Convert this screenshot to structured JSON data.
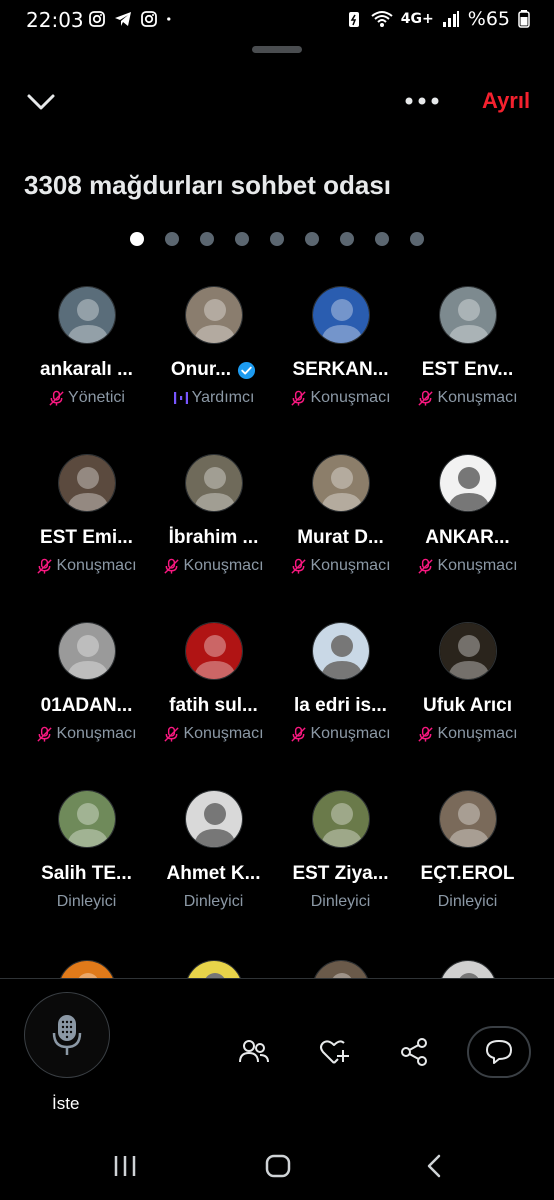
{
  "status": {
    "time": "22:03",
    "battery": "%65",
    "network": "4G+",
    "left_icons": [
      "instagram-icon",
      "telegram-icon",
      "instagram-icon",
      "dot-icon"
    ],
    "right_icons": [
      "battery-saver-icon",
      "wifi-icon",
      "signal-icon",
      "battery-icon"
    ]
  },
  "header": {
    "leave_label": "Ayrıl",
    "title": "3308 mağdurları sohbet odası",
    "page_count": 9,
    "active_page": 0
  },
  "participants": [
    {
      "name": "ankaralı ...",
      "role": "Yönetici",
      "role_icon": "mic-off-icon",
      "verified": false,
      "avatar_bg": "#5a6d7a"
    },
    {
      "name": "Onur...",
      "role": "Yardımcı",
      "role_icon": "audio-wave-icon",
      "verified": true,
      "avatar_bg": "#8a7d6e"
    },
    {
      "name": "SERKAN...",
      "role": "Konuşmacı",
      "role_icon": "mic-off-icon",
      "verified": false,
      "avatar_bg": "#2a5db0"
    },
    {
      "name": "EST Env...",
      "role": "Konuşmacı",
      "role_icon": "mic-off-icon",
      "verified": false,
      "avatar_bg": "#7d8a8f"
    },
    {
      "name": "EST Emi...",
      "role": "Konuşmacı",
      "role_icon": "mic-off-icon",
      "verified": false,
      "avatar_bg": "#5b4a3e"
    },
    {
      "name": "İbrahim ...",
      "role": "Konuşmacı",
      "role_icon": "mic-off-icon",
      "verified": false,
      "avatar_bg": "#6f6a5a"
    },
    {
      "name": "Murat D...",
      "role": "Konuşmacı",
      "role_icon": "mic-off-icon",
      "verified": false,
      "avatar_bg": "#8c7e6a"
    },
    {
      "name": "ANKAR...",
      "role": "Konuşmacı",
      "role_icon": "mic-off-icon",
      "verified": false,
      "avatar_bg": "#f2f2f2"
    },
    {
      "name": "01ADAN...",
      "role": "Konuşmacı",
      "role_icon": "mic-off-icon",
      "verified": false,
      "avatar_bg": "#9a9a9a"
    },
    {
      "name": "fatih sul...",
      "role": "Konuşmacı",
      "role_icon": "mic-off-icon",
      "verified": false,
      "avatar_bg": "#b01414"
    },
    {
      "name": "la edri is...",
      "role": "Konuşmacı",
      "role_icon": "mic-off-icon",
      "verified": false,
      "avatar_bg": "#c9d8e6"
    },
    {
      "name": "Ufuk Arıcı",
      "role": "Konuşmacı",
      "role_icon": "mic-off-icon",
      "verified": false,
      "avatar_bg": "#2a241c"
    },
    {
      "name": "Salih TE...",
      "role": "Dinleyici",
      "role_icon": "",
      "verified": false,
      "avatar_bg": "#6f8a5a"
    },
    {
      "name": "Ahmet K...",
      "role": "Dinleyici",
      "role_icon": "",
      "verified": false,
      "avatar_bg": "#d9d9d9"
    },
    {
      "name": "EST Ziya...",
      "role": "Dinleyici",
      "role_icon": "",
      "verified": false,
      "avatar_bg": "#6a7a4a"
    },
    {
      "name": "EÇT.EROL",
      "role": "Dinleyici",
      "role_icon": "",
      "verified": false,
      "avatar_bg": "#7a6a5a"
    }
  ],
  "partial_avatars": [
    "#e07a1a",
    "#e8d44a",
    "#6a5a4a",
    "#d0d0d0"
  ],
  "bottom": {
    "request_label": "İste",
    "controls": [
      "people-icon",
      "heart-plus-icon",
      "share-icon",
      "chat-icon"
    ]
  },
  "colors": {
    "accent_red": "#f4212e",
    "mic_off_pink": "#f91880",
    "verified_blue": "#1d9bf0",
    "cohost_purple": "#7856ff",
    "muted_text": "#8b98a5"
  }
}
